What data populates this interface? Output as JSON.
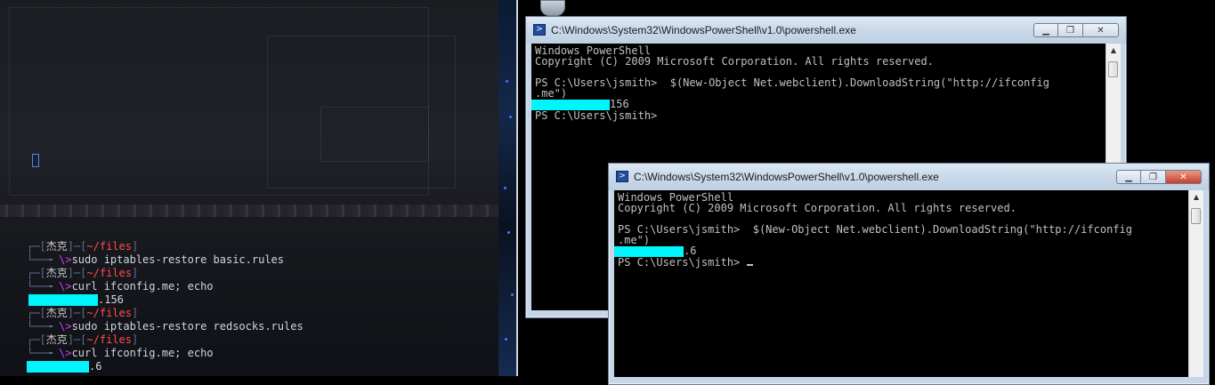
{
  "linux_terminal": {
    "lines": [
      {
        "kind": "prompt",
        "user": "杰克",
        "path": "~/files"
      },
      {
        "kind": "cmd",
        "text": "sudo iptables-restore basic.rules"
      },
      {
        "kind": "prompt",
        "user": "杰克",
        "path": "~/files"
      },
      {
        "kind": "cmd",
        "text": "curl ifconfig.me; echo"
      },
      {
        "kind": "output",
        "suffix": ".156"
      },
      {
        "kind": "prompt",
        "user": "杰克",
        "path": "~/files"
      },
      {
        "kind": "cmd",
        "text": "sudo iptables-restore redsocks.rules"
      },
      {
        "kind": "prompt",
        "user": "杰克",
        "path": "~/files"
      },
      {
        "kind": "cmd",
        "text": "curl ifconfig.me; echo"
      },
      {
        "kind": "output",
        "suffix": ".6"
      }
    ],
    "tree_top": "┌─[",
    "tree_mid": "]─[",
    "tree_end": "]",
    "tree_bottom": "└──╼ ",
    "prompt_char": "\\>"
  },
  "window_back": {
    "title": "C:\\Windows\\System32\\WindowsPowerShell\\v1.0\\powershell.exe",
    "line1": "Windows PowerShell",
    "line2": "Copyright (C) 2009 Microsoft Corporation. All rights reserved.",
    "line3": "PS C:\\Users\\jsmith>  $(New-Object Net.webclient).DownloadString(\"http://ifconfig",
    "line4": ".me\")",
    "line5_suffix": "156",
    "line6": "PS C:\\Users\\jsmith>"
  },
  "window_front": {
    "title": "C:\\Windows\\System32\\WindowsPowerShell\\v1.0\\powershell.exe",
    "line1": "Windows PowerShell",
    "line2": "Copyright (C) 2009 Microsoft Corporation. All rights reserved.",
    "line3": "PS C:\\Users\\jsmith>  $(New-Object Net.webclient).DownloadString(\"http://ifconfig",
    "line4": ".me\")",
    "line5_suffix": ".6",
    "line6": "PS C:\\Users\\jsmith> "
  },
  "colors": {
    "redaction": "#00f5ff",
    "path": "#ff4d4d",
    "prompt_arrow": "#d23cff"
  }
}
